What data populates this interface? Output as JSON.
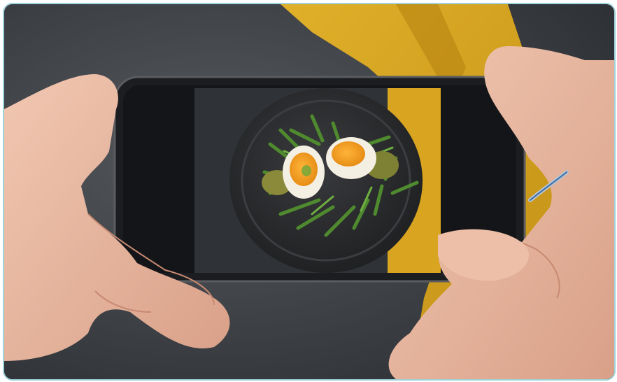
{
  "photo": {
    "subject": "",
    "colors": {
      "frame_border": "#9fd3dc",
      "table": "#3b3e42",
      "napkin": "#d9a520",
      "phone_body": "#1c1d20",
      "plate": "#2a2b2d",
      "arugula": "#4f8a2f",
      "egg_white": "#f4efe3",
      "yolk": "#f2a12a",
      "skin": "#e8b9a2"
    },
    "icons": [
      "smartphone-icon"
    ]
  }
}
